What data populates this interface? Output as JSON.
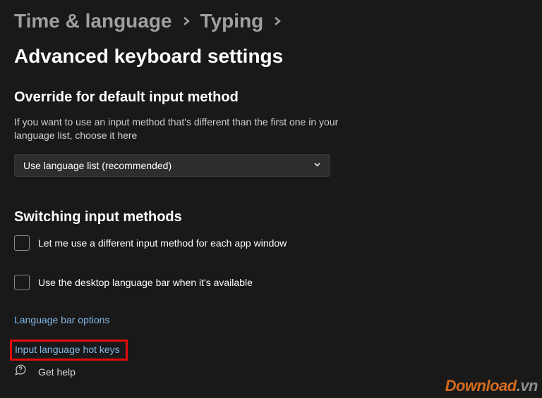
{
  "breadcrumb": {
    "crumb1": "Time & language",
    "crumb2": "Typing",
    "crumb3": "Advanced keyboard settings"
  },
  "override": {
    "heading": "Override for default input method",
    "description": "If you want to use an input method that's different than the first one in your language list, choose it here",
    "dropdown_value": "Use language list (recommended)"
  },
  "switching": {
    "heading": "Switching input methods",
    "checkbox1_label": "Let me use a different input method for each app window",
    "checkbox2_label": "Use the desktop language bar when it's available",
    "link_lang_bar": "Language bar options",
    "link_hotkeys": "Input language hot keys"
  },
  "help": {
    "label": "Get help"
  },
  "watermark": {
    "main": "Download",
    "suffix": ".vn"
  }
}
